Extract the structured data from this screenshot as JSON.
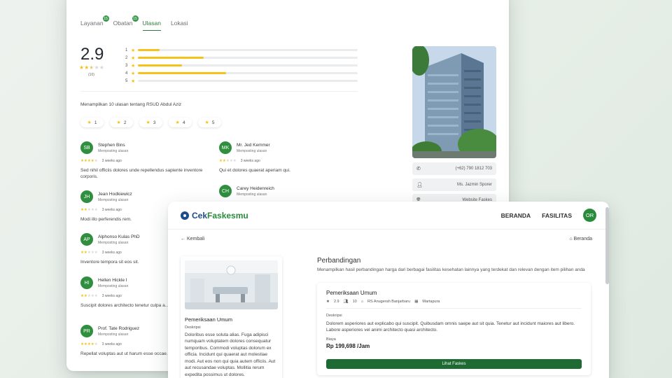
{
  "back_window": {
    "tabs": [
      {
        "label": "Layanan",
        "count": "15"
      },
      {
        "label": "Obatan",
        "count": "15"
      },
      {
        "label": "Ulasan",
        "count": ""
      },
      {
        "label": "Lokasi",
        "count": ""
      }
    ],
    "rating": {
      "value": "2.9",
      "count": "(10)",
      "stars_filled": 2.5
    },
    "bars": [
      {
        "label": "1",
        "fraction": 0.1
      },
      {
        "label": "2",
        "fraction": 0.3
      },
      {
        "label": "3",
        "fraction": 0.2
      },
      {
        "label": "4",
        "fraction": 0.4
      },
      {
        "label": "5",
        "fraction": 0.0
      }
    ],
    "review_summary": "Menampilkan 10 ulasan tentang RSUD Abdul Aziz",
    "filter_chips": [
      "1",
      "2",
      "3",
      "4",
      "5"
    ],
    "reviews": [
      {
        "initials": "SB",
        "name": "Stephen Bins",
        "sub": "Memposting ulasan",
        "time": "3 weeks ago",
        "stars": 4,
        "text": "Sed nihil officiis dolores unde repellendus sapiente inventore corporis."
      },
      {
        "initials": "MK",
        "name": "Mr. Jed Kemmer",
        "sub": "Memposting ulasan",
        "time": "3 weeks ago",
        "stars": 2,
        "text": "Qui et dolores quaerat aperiam qui."
      },
      {
        "initials": "JH",
        "name": "Jean Hodkiewicz",
        "sub": "Memposting ulasan",
        "time": "3 weeks ago",
        "stars": 2,
        "text": "Modi illo perferendis rem."
      },
      {
        "initials": "CH",
        "name": "Carey Heidenreich",
        "sub": "Memposting ulasan",
        "time": "",
        "stars": 0,
        "text": ""
      },
      {
        "initials": "AP",
        "name": "Alphonso Kulas PhD",
        "sub": "Memposting ulasan",
        "time": "3 weeks ago",
        "stars": 2,
        "text": "Inventore tempora sit eos sit."
      },
      {
        "initials": "HI",
        "name": "Hellen Hickle I",
        "sub": "Memposting ulasan",
        "time": "3 weeks ago",
        "stars": 2,
        "text": "Suscipit dolores architecto tenetur culpa a... quae."
      },
      {
        "initials": "PR",
        "name": "Prof. Tate Rodriguez",
        "sub": "Memposting ulasan",
        "time": "3 weeks ago",
        "stars": 4,
        "text": "Repellat voluptas aut ut harum esse occae... repellat."
      }
    ],
    "info": {
      "phone": "(+62) 790 1812 703",
      "contact": "Ms. Jazmin Sporer",
      "website": "Website Faskes"
    }
  },
  "front_window": {
    "logo": {
      "part1": "Cek",
      "part2": "Faskesmu"
    },
    "nav": {
      "beranda": "BERANDA",
      "fasilitas": "FASILITAS",
      "avatar": "OR"
    },
    "back_link": "Kembali",
    "home_link": "Beranda",
    "service_card": {
      "title": "Pemeriksaan Umum",
      "desc_label": "Deskripsi",
      "desc": "Doloribus esse soluta alias. Fuga adipisci numquam voluptatem dolores consequatur temporibus. Commodi voluptas dolorum ex officia. Incidunt qui quaerat aut molestiae modi. Aut eos non qui quia autem officiis. Aut aut recusandae voluptas. Mollitia rerum expedita possimus ut dolores."
    },
    "comparison": {
      "title": "Perbandingan",
      "subtitle": "Menampilkan hasil perbandingan harga dari berbagai fasilitas kesehatan lainnya yang terdekat dan relevan dengan item pilihan anda",
      "item": {
        "title": "Pemeriksaan Umum",
        "rating": "2.9",
        "reviews": "10",
        "facility": "RS Anugerah Banjarbaru",
        "city": "Martapura",
        "desc_label": "Deskripsi",
        "desc": "Dolorem asperiores aut explicabo qui suscipit. Quibusdam omnis saepe aut sit quia. Tenetur aut incidunt maiores aut libero. Labore asperiores vel animi architecto quasi architecto.",
        "price_label": "Biaya",
        "price": "Rp 199,698 /Jam",
        "button": "Lihat Faskes"
      }
    }
  }
}
